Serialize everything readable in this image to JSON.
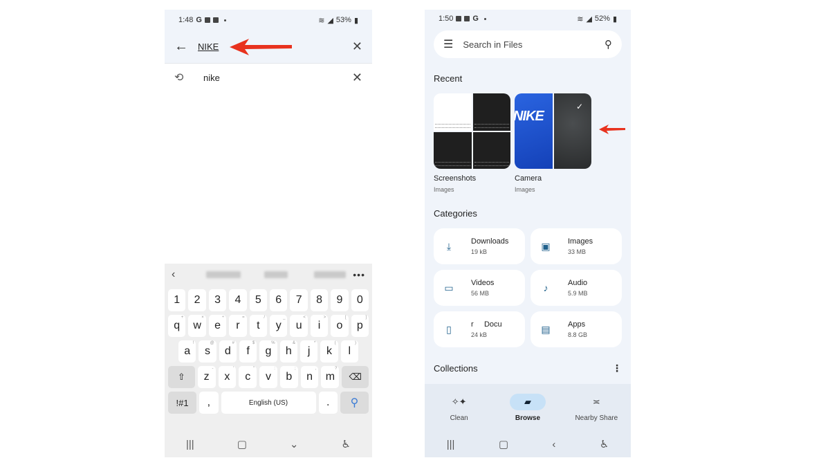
{
  "left_phone": {
    "status": {
      "time": "1:48",
      "battery": "53%"
    },
    "search": {
      "query": "NIKE",
      "back_icon": "arrow-left-icon",
      "clear_icon": "close-icon"
    },
    "history": [
      {
        "text": "nike",
        "icon": "history-icon"
      }
    ],
    "keyboard": {
      "suggestions": [
        "",
        "",
        ""
      ],
      "number_row": [
        "1",
        "2",
        "3",
        "4",
        "5",
        "6",
        "7",
        "8",
        "9",
        "0"
      ],
      "row_q": [
        {
          "k": "q",
          "s": "+"
        },
        {
          "k": "w",
          "s": "×"
        },
        {
          "k": "e",
          "s": "÷"
        },
        {
          "k": "r",
          "s": "="
        },
        {
          "k": "t",
          "s": "/"
        },
        {
          "k": "y",
          "s": "_"
        },
        {
          "k": "u",
          "s": "<"
        },
        {
          "k": "i",
          "s": ">"
        },
        {
          "k": "o",
          "s": "["
        },
        {
          "k": "p",
          "s": "]"
        }
      ],
      "row_a": [
        {
          "k": "a",
          "s": "!"
        },
        {
          "k": "s",
          "s": "@"
        },
        {
          "k": "d",
          "s": "#"
        },
        {
          "k": "f",
          "s": "$"
        },
        {
          "k": "g",
          "s": "%"
        },
        {
          "k": "h",
          "s": "&"
        },
        {
          "k": "j",
          "s": "*"
        },
        {
          "k": "k",
          "s": "("
        },
        {
          "k": "l",
          "s": ")"
        }
      ],
      "row_z": [
        {
          "k": "z",
          "s": "-"
        },
        {
          "k": "x",
          "s": "'"
        },
        {
          "k": "c",
          "s": "\""
        },
        {
          "k": "v",
          "s": ":"
        },
        {
          "k": "b",
          "s": ";"
        },
        {
          "k": "n",
          "s": ","
        },
        {
          "k": "m",
          "s": "?"
        }
      ],
      "symbols_label": "!#1",
      "comma": ",",
      "space_label": "English (US)",
      "period": "."
    }
  },
  "right_phone": {
    "status": {
      "time": "1:50",
      "battery": "52%"
    },
    "search_placeholder": "Search in Files",
    "recent_title": "Recent",
    "recent": [
      {
        "name": "Screenshots",
        "type": "Images"
      },
      {
        "name": "Camera",
        "type": "Images",
        "thumb_text": "NIKE"
      }
    ],
    "categories_title": "Categories",
    "categories": [
      {
        "name": "Downloads",
        "size": "19 kB",
        "icon": "download-icon"
      },
      {
        "name": "Images",
        "size": "33 MB",
        "icon": "image-icon"
      },
      {
        "name": "Videos",
        "size": "56 MB",
        "icon": "video-icon"
      },
      {
        "name": "Audio",
        "size": "5.9 MB",
        "icon": "music-note-icon"
      },
      {
        "name": "r     Docu",
        "size": "24 kB",
        "icon": "document-icon"
      },
      {
        "name": "Apps",
        "size": "8.8 GB",
        "icon": "android-icon"
      }
    ],
    "collections_title": "Collections",
    "bottom_nav": [
      {
        "label": "Clean",
        "icon": "sparkle-icon",
        "active": false
      },
      {
        "label": "Browse",
        "icon": "folder-search-icon",
        "active": true
      },
      {
        "label": "Nearby Share",
        "icon": "nearby-share-icon",
        "active": false
      }
    ]
  },
  "colors": {
    "annotation_arrow": "#e8321e",
    "accent_icon": "#21618c",
    "active_pill": "#c7e1f7"
  }
}
